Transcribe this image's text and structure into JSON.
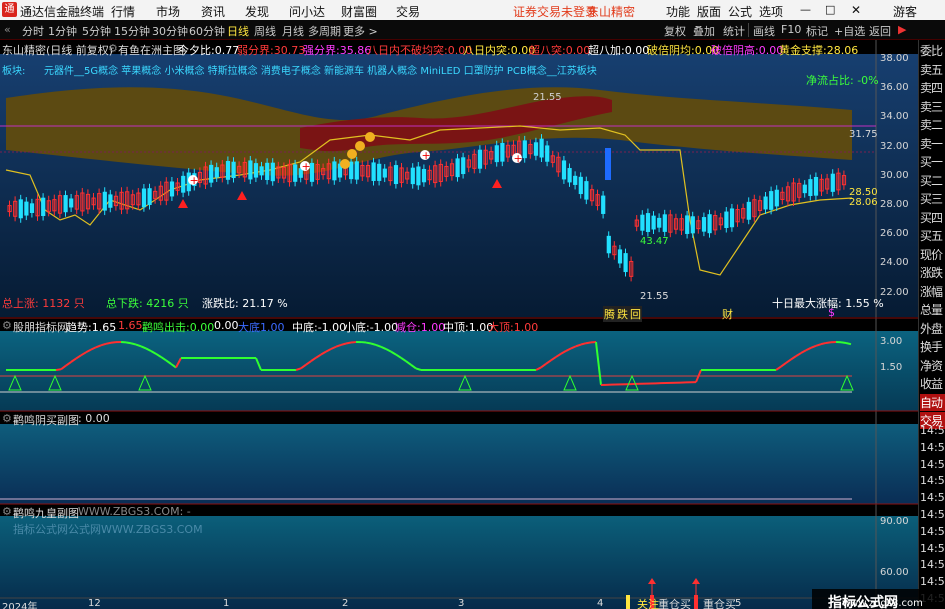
{
  "menubar": {
    "app_name": "通达信金融终端",
    "items": [
      "行情",
      "市场",
      "资讯",
      "发现",
      "问小达",
      "财富圈",
      "交易"
    ],
    "warning": "证券交易未登录",
    "broker": "东山精密",
    "right": [
      "功能",
      "版面",
      "公式",
      "选项"
    ],
    "guest": "游客"
  },
  "periodbar": {
    "periods": [
      "分时",
      "1分钟",
      "5分钟",
      "15分钟",
      "30分钟",
      "60分钟",
      "日线",
      "周线",
      "月线",
      "多周期",
      "更多 >"
    ],
    "active": "日线",
    "tools": [
      "复权",
      "叠加",
      "统计",
      "画线",
      "F10",
      "标记",
      "+自选",
      "返回"
    ]
  },
  "main_header": {
    "stock": "东山精密(日线 前复权)",
    "indicator": "有鱼在洲主图",
    "items": [
      {
        "label": "今夕比:",
        "value": "0.77",
        "color": "#ffffff"
      },
      {
        "label": "弱分界:",
        "value": "30.73",
        "color": "#ff3b3b"
      },
      {
        "label": "强分界:",
        "value": "35.86",
        "color": "#ff3bff"
      },
      {
        "label": "八日内不破均突:",
        "value": "0.00",
        "color": "#ff3b3b"
      },
      {
        "label": "八日内突:",
        "value": "0.00",
        "color": "#ffe640"
      },
      {
        "label": "超八突:",
        "value": "0.00",
        "color": "#ff3b3b"
      },
      {
        "label": "超八加:",
        "value": "0.00",
        "color": "#ffffff"
      },
      {
        "label": "破倍阴均:",
        "value": "0.00",
        "color": "#ffe640"
      },
      {
        "label": "破倍阴高:",
        "value": "0.00",
        "color": "#ff3bff"
      },
      {
        "label": "黄金支撑:",
        "value": "28.06",
        "color": "#ffe640"
      }
    ]
  },
  "concepts": {
    "label": "板块:",
    "text": "元器件__5G概念 苹果概念 小米概念 特斯拉概念 消费电子概念 新能源车 机器人概念 MiniLED 口罩防护 PCB概念__江苏板块"
  },
  "main_footer": {
    "total_up": "总上涨: 1132 只",
    "total_down": "总下跌: 4216 只",
    "ratio": "涨跌比: 21.17 %",
    "ten_day": "十日最大涨幅: 1.55 %",
    "net_flow": "净流占比: -0%"
  },
  "price_axis": [
    "38.00",
    "36.00",
    "34.00",
    "32.00",
    "30.00",
    "28.00",
    "26.00",
    "24.00",
    "22.00"
  ],
  "annotations": {
    "low_price": "21.55",
    "line_3175": "31.75",
    "p2850": "28.50",
    "p2806": "28.06",
    "ghost1": "43.47",
    "ghost2": "21.55"
  },
  "event_marks": [
    "腾",
    "跌",
    "回",
    "财",
    "$"
  ],
  "panel2": {
    "title": "股朋指标网",
    "items": [
      {
        "label": "趋势:",
        "value": "1.65",
        "color": "#ffffff"
      },
      {
        "label": "",
        "value": "1.65",
        "color": "#ff3b3b"
      },
      {
        "label": "鹳鸣出击:",
        "value": "0.00",
        "color": "#3bff3b"
      },
      {
        "label": "",
        "value": "0.00",
        "color": "#ffffff"
      },
      {
        "label": "大底",
        "value": "1.00",
        "color": "#3b6bff"
      },
      {
        "label": "中底:",
        "value": "-1.00",
        "color": "#ffffff"
      },
      {
        "label": "小底:",
        "value": "-1.00",
        "color": "#ffffff"
      },
      {
        "label": "减仓:",
        "value": "1.00",
        "color": "#ff3bff"
      },
      {
        "label": "中顶:",
        "value": "1.00",
        "color": "#ffffff"
      },
      {
        "label": "大顶:",
        "value": "1.00",
        "color": "#ff3b3b"
      }
    ],
    "axis": [
      "3.00",
      "1.50"
    ]
  },
  "panel3": {
    "title": "鹳鸣阴买副图",
    "value": ": 0.00"
  },
  "panel4": {
    "title": "鹳鸣九皇副图",
    "watermark": "WWW.ZBGS3.COM: -",
    "watermark2": "指标公式网公式网WWW.ZBGS3.COM",
    "axis": [
      "90.00",
      "60.00"
    ],
    "labels": [
      "关注",
      "重仓买",
      "重仓买"
    ]
  },
  "date_axis": [
    "2024年",
    "12",
    "1",
    "2",
    "3",
    "4",
    "5"
  ],
  "sidebar": {
    "items": [
      "委比",
      "卖五",
      "卖四",
      "卖三",
      "卖二",
      "卖一",
      "买一",
      "买二",
      "买三",
      "买四",
      "买五",
      "现价",
      "涨跌",
      "涨幅",
      "总量",
      "外盘",
      "换手",
      "净资",
      "收益",
      "自动",
      "交易"
    ],
    "times": [
      "14:5",
      "14:5",
      "14:5",
      "14:5",
      "14:5",
      "14:5",
      "14:5",
      "14:5",
      "14:5",
      "14:5",
      "14:5"
    ]
  },
  "watermark": {
    "name": "指标公式网",
    "url": "www.zbgs3.com"
  },
  "colors": {
    "up": "#ff3030",
    "down": "#22e0ff",
    "yellow": "#ffe640",
    "band_top": "#5b0b0b",
    "band": "#5e4a12",
    "bg_top": "#153c6a",
    "bg_bottom": "#06203b"
  }
}
